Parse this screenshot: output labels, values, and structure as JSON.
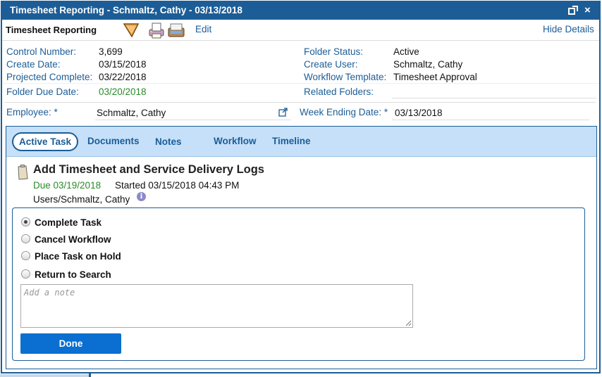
{
  "window": {
    "title": "Timesheet Reporting - Schmaltz, Cathy - 03/13/2018",
    "close_glyph": "×"
  },
  "toolbar": {
    "app_label": "Timesheet Reporting",
    "edit_label": "Edit",
    "hide_details_label": "Hide Details",
    "icons": [
      "filter-icon",
      "print-icon",
      "scan-icon"
    ]
  },
  "details": {
    "control_number_label": "Control Number:",
    "control_number": "3,699",
    "create_date_label": "Create Date:",
    "create_date": "03/15/2018",
    "projected_complete_label": "Projected Complete:",
    "projected_complete": "03/22/2018",
    "folder_due_date_label": "Folder Due Date:",
    "folder_due_date": "03/20/2018",
    "folder_status_label": "Folder Status:",
    "folder_status": "Active",
    "create_user_label": "Create User:",
    "create_user": "Schmaltz, Cathy",
    "workflow_template_label": "Workflow Template:",
    "workflow_template": "Timesheet Approval",
    "related_folders_label": "Related Folders:"
  },
  "fields": {
    "employee_label": "Employee: *",
    "employee_value": "Schmaltz, Cathy",
    "week_ending_label": "Week Ending Date: *",
    "week_ending_value": "03/13/2018"
  },
  "tabs": [
    {
      "label": "Active Task",
      "active": true
    },
    {
      "label": "Documents"
    },
    {
      "label": "Notes"
    },
    {
      "label": "Workflow"
    },
    {
      "label": "Timeline"
    }
  ],
  "task": {
    "title": "Add Timesheet and Service Delivery Logs",
    "due": "Due 03/19/2018",
    "started": "Started 03/15/2018 04:43 PM",
    "assignee": "Users/Schmaltz, Cathy",
    "info_glyph": "i"
  },
  "actions": {
    "options": [
      {
        "label": "Complete Task",
        "selected": true
      },
      {
        "label": "Cancel Workflow"
      },
      {
        "label": "Place Task on Hold"
      },
      {
        "label": "Return to Search"
      }
    ],
    "note_placeholder": "Add a note",
    "done_label": "Done"
  },
  "colors": {
    "primary": "#1c5d97",
    "tab_bar": "#c5e0f8",
    "done_button": "#0a6fd0",
    "due_green": "#2a8a2a"
  }
}
